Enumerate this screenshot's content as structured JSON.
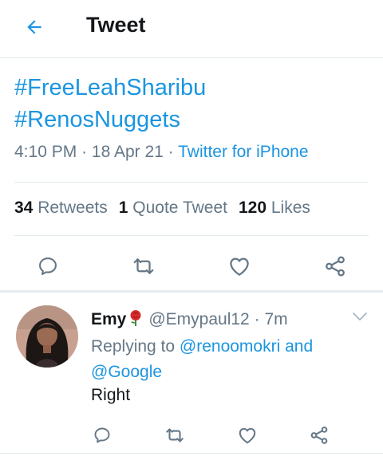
{
  "header": {
    "back_icon": "arrow-left-icon",
    "title": "Tweet"
  },
  "tweet": {
    "hashtags": [
      "#FreeLeahSharibu",
      "#RenosNuggets"
    ],
    "time": "4:10 PM",
    "date": "18 Apr 21",
    "separator": "·",
    "source": "Twitter for iPhone",
    "stats": {
      "retweets_count": "34",
      "retweets_label": "Retweets",
      "quotes_count": "1",
      "quotes_label": "Quote Tweet",
      "likes_count": "120",
      "likes_label": "Likes"
    }
  },
  "actions": [
    "reply-icon",
    "retweet-icon",
    "like-icon",
    "share-icon"
  ],
  "reply": {
    "name": "Emy",
    "emoji": "rose-icon",
    "handle": "@Emypaul12",
    "separator": "·",
    "age": "7m",
    "replying_prefix": "Replying to",
    "mention_1": "@renoomokri",
    "conjunction": "and",
    "mention_2": "@Google",
    "text": "Right"
  },
  "colors": {
    "accent": "#1b95e0",
    "text_primary": "#14171a",
    "text_secondary": "#657786",
    "divider": "#e1e8ed"
  }
}
